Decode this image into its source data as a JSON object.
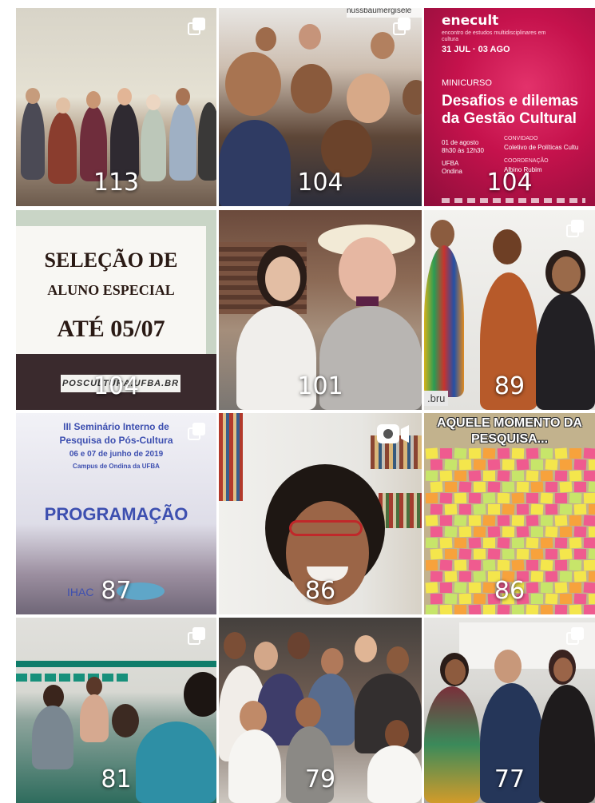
{
  "tiles": [
    {
      "count": "113",
      "multi": true
    },
    {
      "count": "104",
      "multi": true,
      "header_user": "nussbaumergisele"
    },
    {
      "count": "104",
      "multi": false,
      "poster": {
        "brand": "enecult",
        "tagline": "encontro de estudos multidisciplinares em cultura",
        "dates": "31 JUL · 03 AGO",
        "type": "MINICURSO",
        "title_line1": "Desafios e dilemas",
        "title_line2": "da Gestão Cultural",
        "date_info": "01 de agosto\n8h30 às 12h30",
        "guest_label": "CONVIDADO",
        "guest_name": "Coletivo de Políticas Cultu",
        "place": "UFBA\nOndina",
        "coord_label": "COORDENAÇÃO",
        "coord_name": "Albino Rubim"
      }
    },
    {
      "count": "104",
      "multi": false,
      "poster": {
        "line1": "SELEÇÃO DE",
        "line2": "ALUNO ESPECIAL",
        "line3": "ATÉ 05/07",
        "footer": "POSCULTURA.UFBA.BR"
      }
    },
    {
      "count": "101",
      "multi": false
    },
    {
      "count": "89",
      "multi": true,
      "corner_text": ".bru"
    },
    {
      "count": "87",
      "multi": true,
      "poster": {
        "line1": "III Seminário Interno de",
        "line2": "Pesquisa do Pós-Cultura",
        "line3": "06 e 07 de junho de 2019",
        "line4": "Campus de Ondina da UFBA",
        "line5": "PROGRAMAÇÃO",
        "logo": "IHAC"
      }
    },
    {
      "count": "86",
      "multi": false,
      "video": true
    },
    {
      "count": "86",
      "multi": false,
      "poster": {
        "line1": "AQUELE MOMENTO DA",
        "line2": "PESQUISA..."
      }
    },
    {
      "count": "81",
      "multi": true
    },
    {
      "count": "79",
      "multi": false
    },
    {
      "count": "77",
      "multi": true
    }
  ],
  "colors": {
    "enecult_magenta": "#c5124c",
    "enecult_dark": "#9d0f3e",
    "poster_green": "#dde4d8",
    "poster_text": "#2a1a14",
    "seminar_blue": "#3d4fb0",
    "sticky_yellow": "#f4e64c",
    "sticky_pink": "#ef5b8f",
    "sticky_green": "#c7e56a"
  }
}
